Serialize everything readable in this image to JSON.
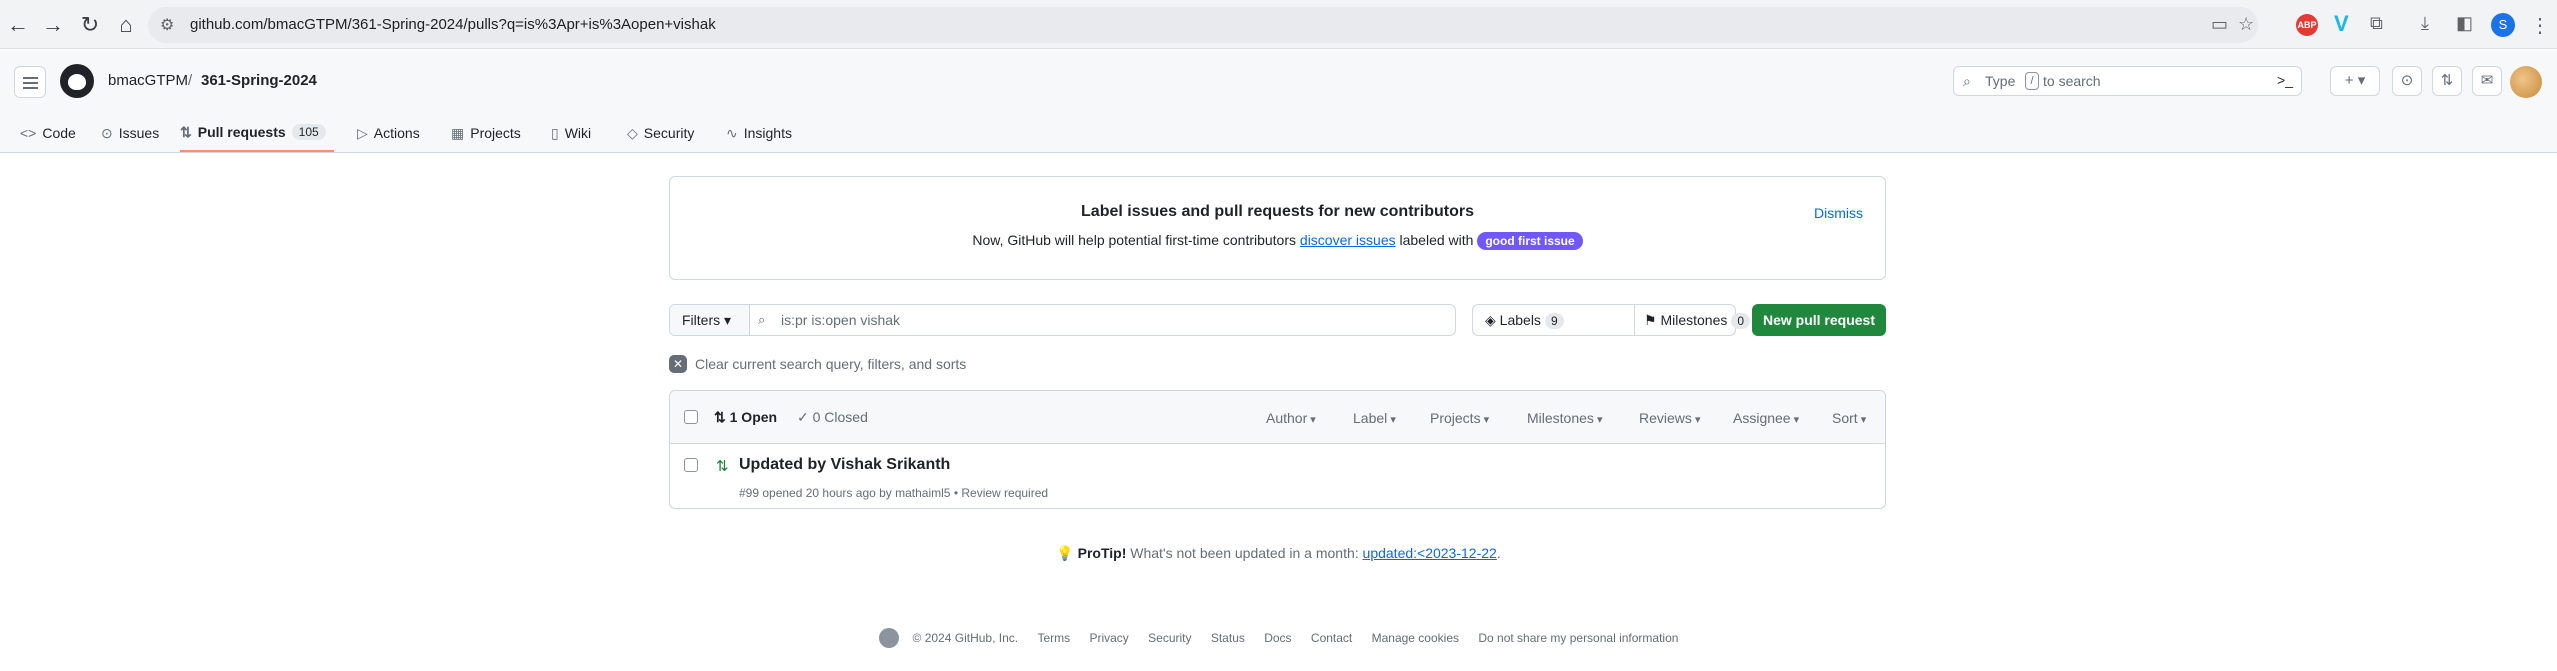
{
  "browser": {
    "url": "github.com/bmacGTPM/361-Spring-2024/pulls?q=is%3Apr+is%3Aopen+vishak",
    "profile_initial": "S",
    "abp_label": "ABP"
  },
  "header": {
    "owner": "bmacGTPM",
    "separator": "/",
    "repo": "361-Spring-2024",
    "search_prefix": "Type",
    "search_key": "/",
    "search_suffix": "to search"
  },
  "tabs": [
    {
      "label": "Code",
      "icon": "code-icon"
    },
    {
      "label": "Issues",
      "icon": "issue-opened-icon"
    },
    {
      "label": "Pull requests",
      "icon": "git-pull-request-icon",
      "count": "105"
    },
    {
      "label": "Actions",
      "icon": "play-icon"
    },
    {
      "label": "Projects",
      "icon": "table-icon"
    },
    {
      "label": "Wiki",
      "icon": "book-icon"
    },
    {
      "label": "Security",
      "icon": "shield-icon"
    },
    {
      "label": "Insights",
      "icon": "graph-icon"
    }
  ],
  "banner": {
    "title": "Label issues and pull requests for new contributors",
    "desc_before": "Now, GitHub will help potential first-time contributors ",
    "desc_link": "discover issues",
    "desc_after": " labeled with ",
    "label": "good first issue",
    "dismiss": "Dismiss"
  },
  "toolbar": {
    "filters": "Filters",
    "query": "is:pr is:open vishak",
    "labels": "Labels",
    "labels_count": "9",
    "milestones": "Milestones",
    "milestones_count": "0",
    "new_pr": "New pull request"
  },
  "clear_text": "Clear current search query, filters, and sorts",
  "list": {
    "open": "1 Open",
    "closed": "0 Closed",
    "filters": [
      "Author",
      "Label",
      "Projects",
      "Milestones",
      "Reviews",
      "Assignee",
      "Sort"
    ],
    "items": [
      {
        "title": "Updated by Vishak Srikanth",
        "meta": "#99 opened 20 hours ago by mathaiml5 • Review required"
      }
    ]
  },
  "protip": {
    "bold": "ProTip!",
    "text": " What's not been updated in a month: ",
    "link": "updated:<2023-12-22",
    "end": "."
  },
  "footer": {
    "copyright": "© 2024 GitHub, Inc.",
    "links": [
      "Terms",
      "Privacy",
      "Security",
      "Status",
      "Docs",
      "Contact",
      "Manage cookies",
      "Do not share my personal information"
    ]
  },
  "colors": {
    "accent_underline": "#fd8c73",
    "primary_button": "#1f883d",
    "link": "#0969da",
    "label_purple": "#7057ff",
    "pr_open": "#1a7f37"
  }
}
